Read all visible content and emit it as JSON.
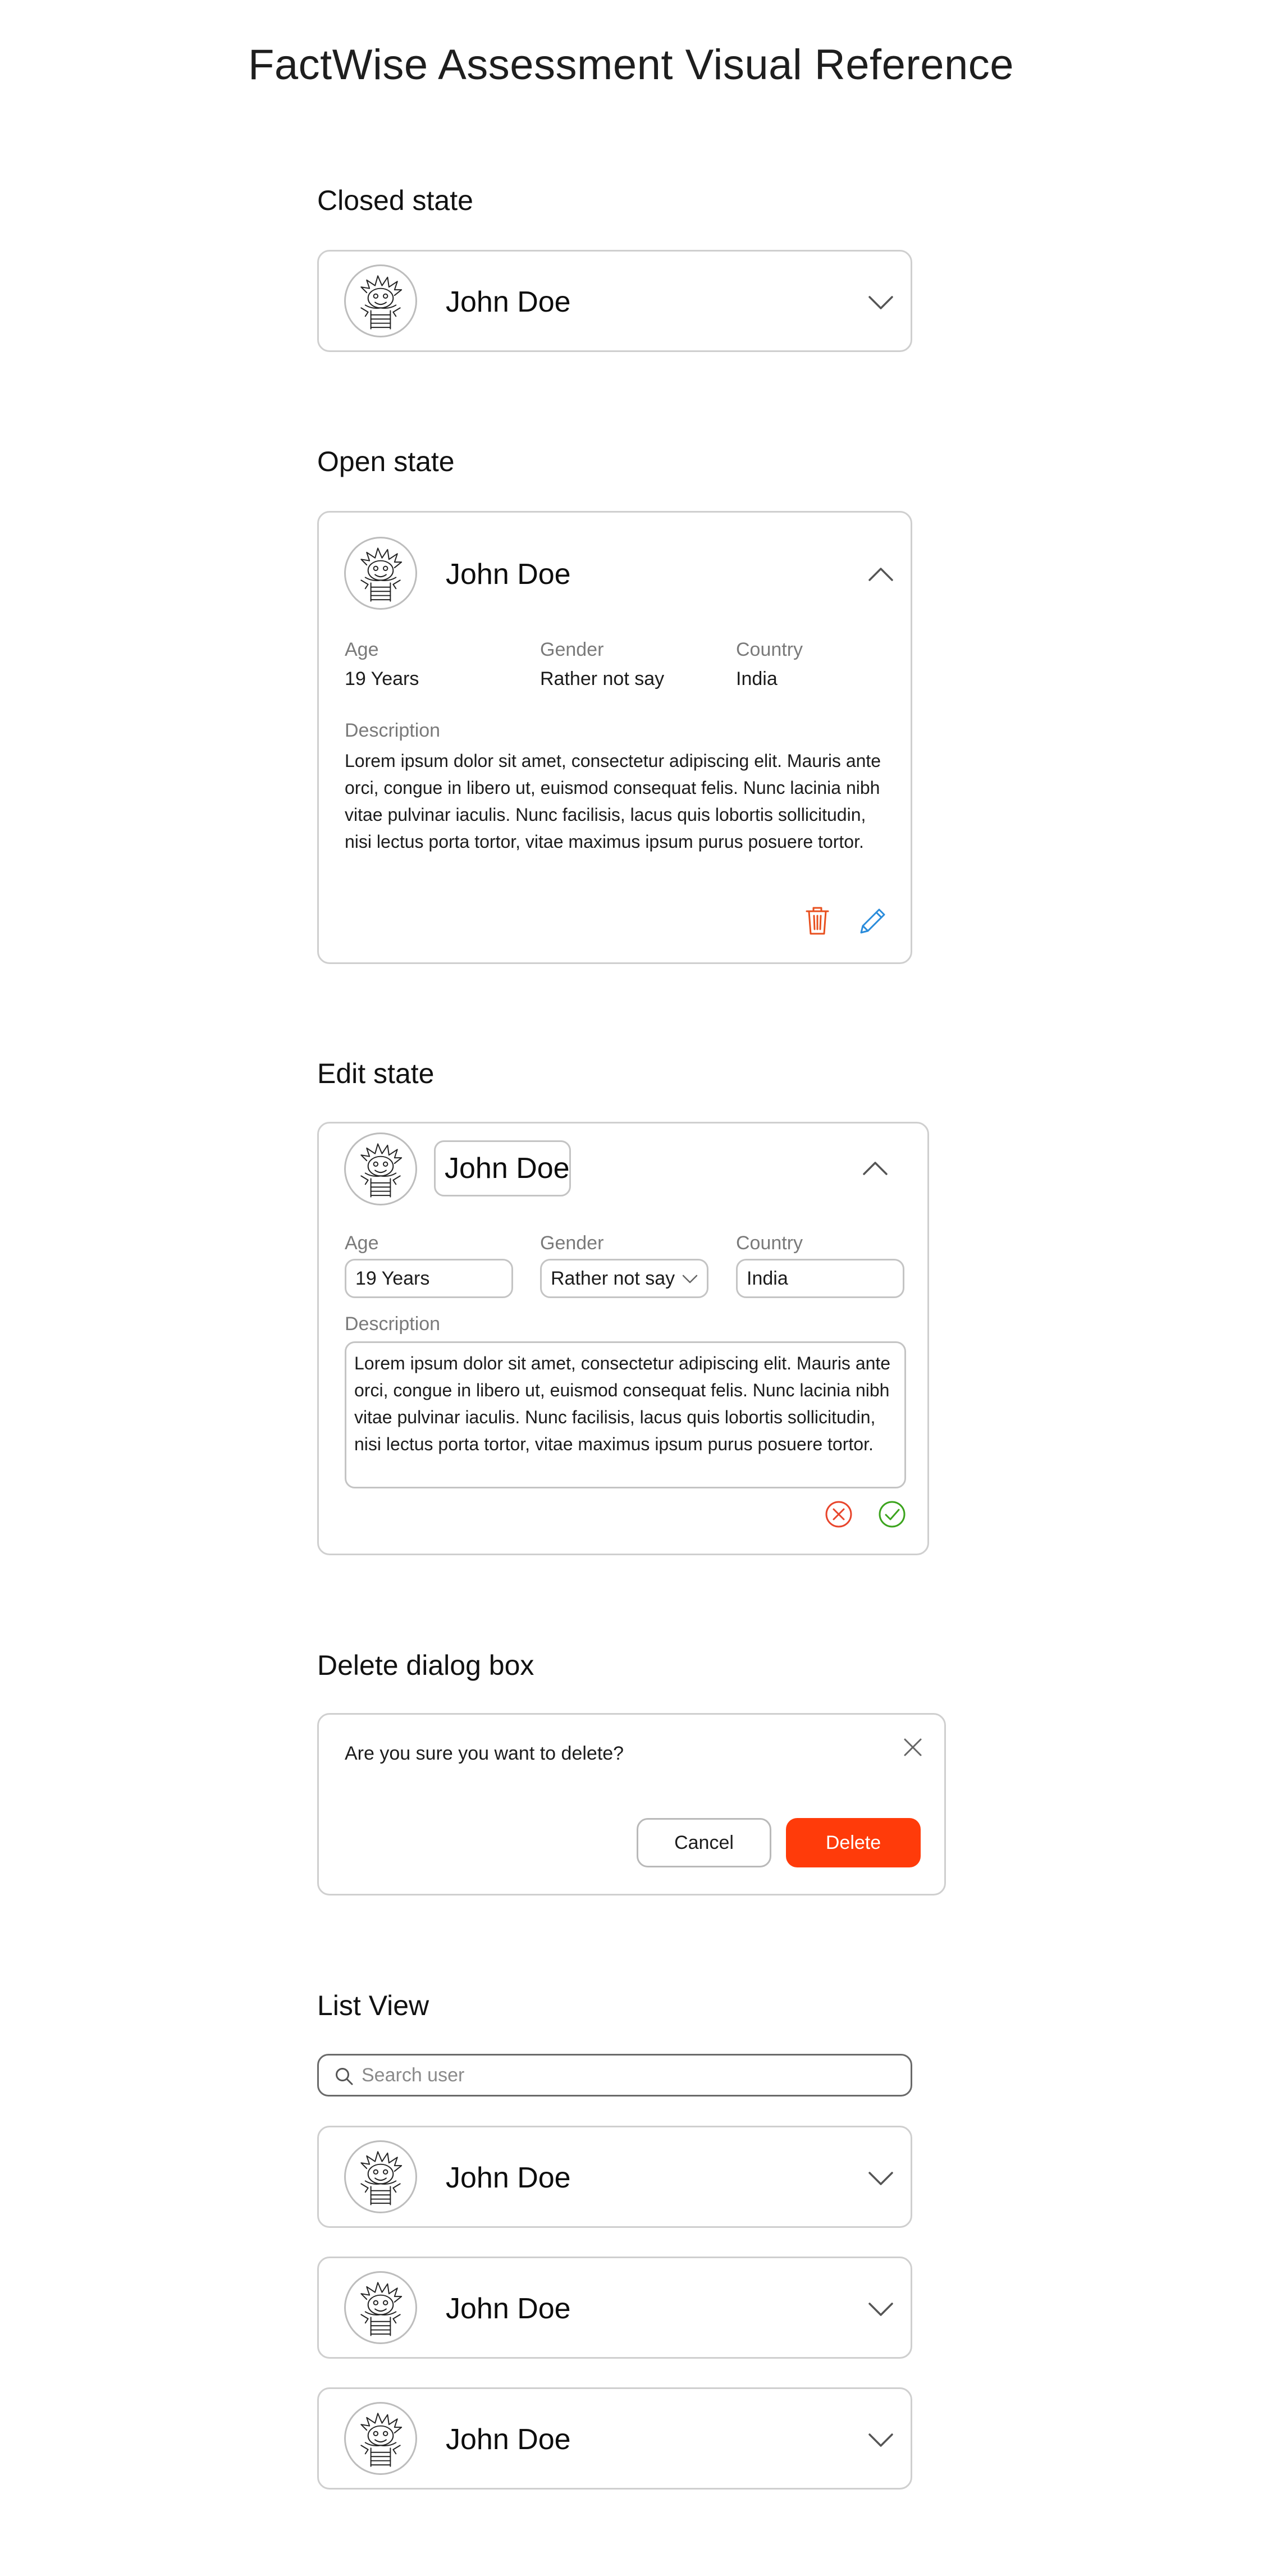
{
  "page": {
    "title": "FactWise Assessment Visual Reference"
  },
  "sections": {
    "closed": "Closed state",
    "open": "Open state",
    "edit": "Edit state",
    "delete": "Delete dialog box",
    "list": "List View"
  },
  "user": {
    "name": "John Doe",
    "age_label": "Age",
    "age_value": "19 Years",
    "gender_label": "Gender",
    "gender_value": "Rather not say",
    "country_label": "Country",
    "country_value": "India",
    "description_label": "Description",
    "description": "Lorem ipsum dolor sit amet, consectetur adipiscing elit. Mauris ante orci, congue in libero ut, euismod consequat felis. Nunc lacinia nibh vitae pulvinar iaculis. Nunc facilisis, lacus quis lobortis sollicitudin, nisi lectus porta tortor, vitae maximus ipsum purus posuere tortor."
  },
  "dialog": {
    "message": "Are you sure you want to delete?",
    "cancel_label": "Cancel",
    "delete_label": "Delete"
  },
  "search": {
    "placeholder": "Search user"
  },
  "list": [
    {
      "name": "John Doe"
    },
    {
      "name": "John Doe"
    },
    {
      "name": "John Doe"
    }
  ],
  "colors": {
    "delete": "#ff3b0a",
    "delete_icon": "#e8501f",
    "edit_icon": "#2a8cdb",
    "cancel_icon": "#e8452c",
    "confirm_icon": "#3ba41d",
    "border": "#cfcfcf"
  },
  "icons": {
    "chevron_down": "chevron-down-icon",
    "chevron_up": "chevron-up-icon",
    "trash": "trash-icon",
    "pencil": "pencil-icon",
    "cancel": "x-circle-icon",
    "confirm": "check-circle-icon",
    "close": "close-icon",
    "search": "search-icon"
  }
}
